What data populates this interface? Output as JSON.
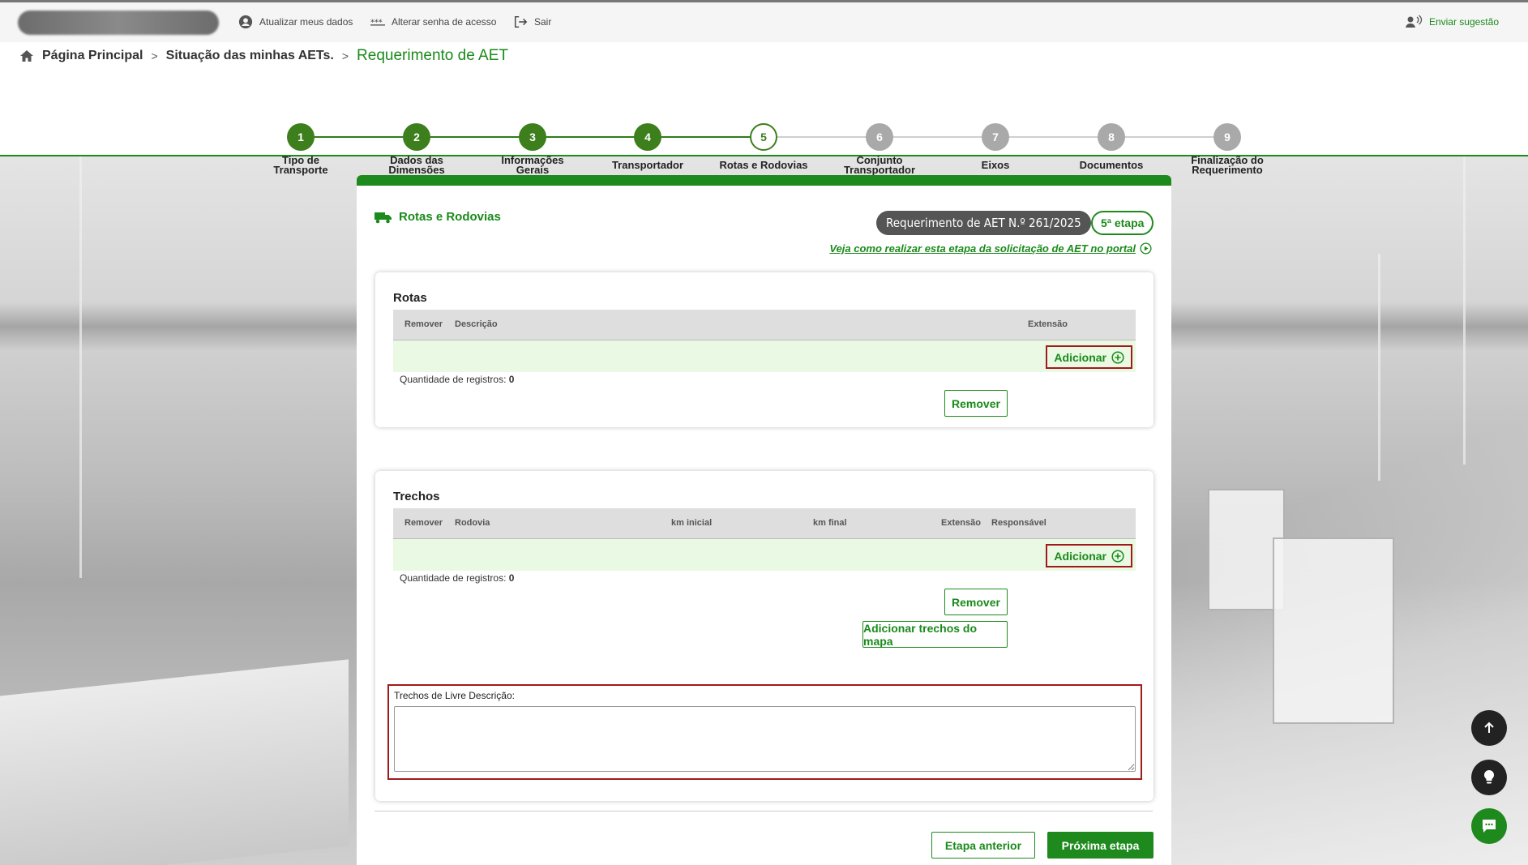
{
  "topbar": {
    "update_data": "Atualizar meus dados",
    "change_password": "Alterar senha de acesso",
    "logout": "Sair",
    "send_suggestion": "Enviar sugestão"
  },
  "breadcrumb": {
    "home": "Página Principal",
    "status": "Situação das minhas AETs.",
    "current": "Requerimento de AET"
  },
  "steps": [
    {
      "num": "1",
      "label": "Tipo de Transporte",
      "state": "done"
    },
    {
      "num": "2",
      "label": "Dados das Dimensões",
      "state": "done"
    },
    {
      "num": "3",
      "label": "Informações Gerais",
      "state": "done"
    },
    {
      "num": "4",
      "label": "Transportador",
      "state": "done"
    },
    {
      "num": "5",
      "label": "Rotas e Rodovias",
      "state": "current"
    },
    {
      "num": "6",
      "label": "Conjunto Transportador",
      "state": "pending"
    },
    {
      "num": "7",
      "label": "Eixos",
      "state": "pending"
    },
    {
      "num": "8",
      "label": "Documentos",
      "state": "pending"
    },
    {
      "num": "9",
      "label": "Finalização do Requerimento",
      "state": "pending"
    }
  ],
  "panel": {
    "title": "Rotas e Rodovias",
    "request_badge": "Requerimento de AET N.º 261/2025",
    "stage_badge": "5ª etapa",
    "help_link": "Veja como realizar esta etapa da solicitação de AET no portal"
  },
  "rotas": {
    "title": "Rotas",
    "columns": [
      "Remover",
      "Descrição",
      "Extensão"
    ],
    "add_label": "Adicionar",
    "count_label": "Quantidade de registros:",
    "count_value": "0",
    "remove_label": "Remover"
  },
  "trechos": {
    "title": "Trechos",
    "columns": [
      "Remover",
      "Rodovia",
      "km inicial",
      "km final",
      "Extensão",
      "Responsável"
    ],
    "add_label": "Adicionar",
    "count_label": "Quantidade de registros:",
    "count_value": "0",
    "remove_label": "Remover",
    "add_from_map_label": "Adicionar trechos do mapa",
    "free_description_label": "Trechos de Livre Descrição:",
    "free_description_value": ""
  },
  "footer": {
    "prev_label": "Etapa anterior",
    "next_label": "Próxima etapa"
  },
  "colors": {
    "primary": "#1e8a1e",
    "step_done": "#3d7f1d",
    "step_pending": "#a9a9a9",
    "highlight_border": "#a11a1a"
  }
}
